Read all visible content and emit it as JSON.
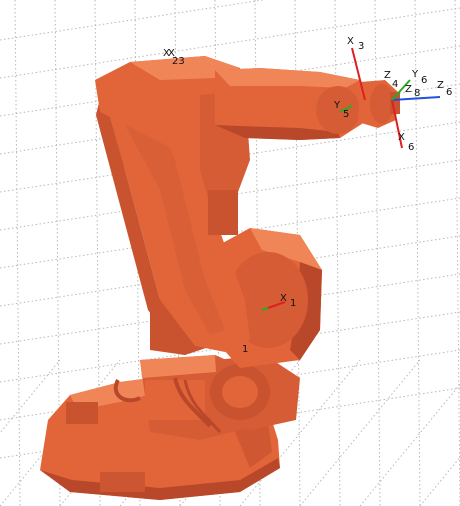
{
  "viewport": {
    "background": "#ffffff",
    "grid_color": "#b8b8b8",
    "robot_color": "#e2653a",
    "robot_shadow": "#b9482a",
    "robot_highlight": "#f08658"
  },
  "frame_labels": {
    "x1": "X",
    "n1": "1",
    "x23": "X",
    "n23": "23",
    "x3": "X",
    "n3": "3",
    "y5": "Y",
    "n5": "5",
    "z4": "Z",
    "n4": "4",
    "y6": "Y",
    "n6a": "6",
    "n8": "8",
    "z6": "Z",
    "n6b": "6",
    "x6": "X",
    "n6c": "6",
    "base_mark": "1"
  },
  "axis_colors": {
    "x": "#e02020",
    "y": "#20b020",
    "z": "#2050e0"
  }
}
